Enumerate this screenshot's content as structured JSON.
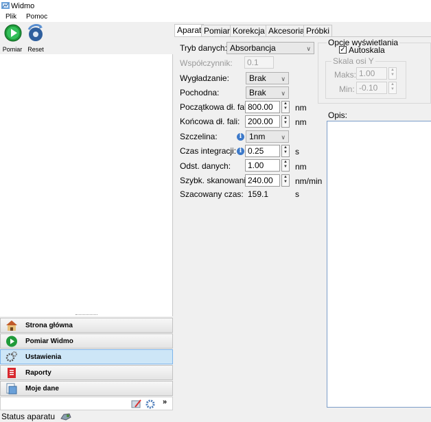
{
  "window": {
    "title": "Widmo"
  },
  "menu": {
    "items": [
      "Plik",
      "Pomoc"
    ]
  },
  "toolbar": {
    "measure_label": "Pomiar",
    "reset_label": "Reset"
  },
  "nav": {
    "items": [
      {
        "label": "Strona główna",
        "icon": "home-icon",
        "selected": false
      },
      {
        "label": "Pomiar Widmo",
        "icon": "play-icon",
        "selected": false
      },
      {
        "label": "Ustawienia",
        "icon": "gears-icon",
        "selected": true
      },
      {
        "label": "Raporty",
        "icon": "reports-icon",
        "selected": false
      },
      {
        "label": "Moje dane",
        "icon": "my-data-icon",
        "selected": false
      }
    ],
    "footer_more": "»"
  },
  "tabs": [
    "Aparat",
    "Pomiar",
    "Korekcja",
    "Akcesoria",
    "Próbki"
  ],
  "active_tab": "Aparat",
  "form": {
    "data_mode_label": "Tryb danych:",
    "data_mode_value": "Absorbancja",
    "coefficient_label": "Współczynnik:",
    "coefficient_value": "0.1",
    "smoothing_label": "Wygładzanie:",
    "smoothing_value": "Brak",
    "derivative_label": "Pochodna:",
    "derivative_value": "Brak",
    "start_wl_label": "Początkowa dł. fali:",
    "start_wl_value": "800.00",
    "end_wl_label": "Końcowa dł. fali:",
    "end_wl_value": "200.00",
    "slit_label": "Szczelina:",
    "slit_value": "1nm",
    "integration_label": "Czas integracji:",
    "integration_value": "0.25",
    "interval_label": "Odst. danych:",
    "interval_value": "1.00",
    "scan_speed_label": "Szybk. skanowania:",
    "scan_speed_value": "240.00",
    "est_time_label": "Szacowany czas:",
    "est_time_value": "159.1",
    "unit_nm": "nm",
    "unit_s": "s",
    "unit_nm_min": "nm/min",
    "info_glyph": "i"
  },
  "display": {
    "group_label": "Opcje wyświetlania",
    "autoscale_label": "Autoskala",
    "autoscale_checked": true,
    "axis_group_label": "Skala osi Y",
    "max_label": "Maks:",
    "max_value": "1.00",
    "min_label": "Min:",
    "min_value": "-0.10"
  },
  "description": {
    "label": "Opis:",
    "value": ""
  },
  "status": {
    "text": "Status aparatu"
  },
  "colors": {
    "selected_nav": "#cde6f7",
    "accent_border": "#7eb4ea"
  }
}
